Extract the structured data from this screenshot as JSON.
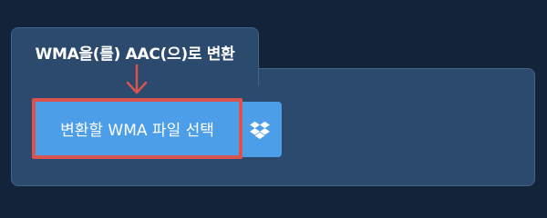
{
  "tab": {
    "title": "WMA을(를) AAC(으)로 변환"
  },
  "upload": {
    "choose_button_label": "변환할 WMA 파일 선택",
    "dropbox_icon": "dropbox-icon"
  },
  "colors": {
    "background": "#12233a",
    "panel": "#2c4a6d",
    "button": "#4c9ee8",
    "highlight": "#d9534f"
  }
}
